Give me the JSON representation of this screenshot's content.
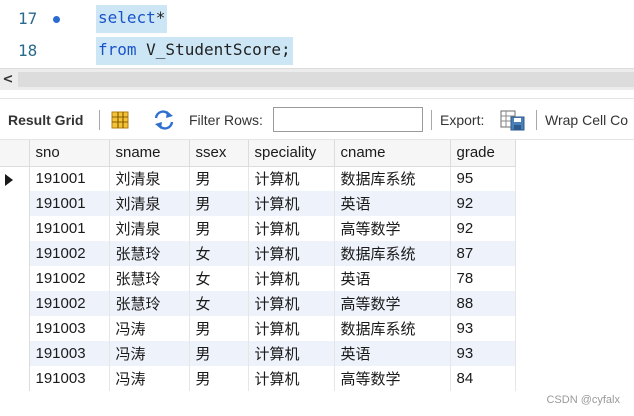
{
  "editor": {
    "lines": [
      {
        "number": "17",
        "text_keyword": "select",
        "text_rest": "*"
      },
      {
        "number": "18",
        "text_keyword": "from",
        "text_rest": " V_StudentScore;"
      }
    ]
  },
  "scrollbar": {
    "left_arrow": "<"
  },
  "toolbar": {
    "result_grid": "Result Grid",
    "filter_rows": "Filter Rows:",
    "filter_value": "",
    "export": "Export:",
    "wrap_cell": "Wrap Cell Co"
  },
  "grid": {
    "columns": [
      "sno",
      "sname",
      "ssex",
      "speciality",
      "cname",
      "grade"
    ],
    "rows": [
      [
        "191001",
        "刘清泉",
        "男",
        "计算机",
        "数据库系统",
        "95"
      ],
      [
        "191001",
        "刘清泉",
        "男",
        "计算机",
        "英语",
        "92"
      ],
      [
        "191001",
        "刘清泉",
        "男",
        "计算机",
        "高等数学",
        "92"
      ],
      [
        "191002",
        "张慧玲",
        "女",
        "计算机",
        "数据库系统",
        "87"
      ],
      [
        "191002",
        "张慧玲",
        "女",
        "计算机",
        "英语",
        "78"
      ],
      [
        "191002",
        "张慧玲",
        "女",
        "计算机",
        "高等数学",
        "88"
      ],
      [
        "191003",
        "冯涛",
        "男",
        "计算机",
        "数据库系统",
        "93"
      ],
      [
        "191003",
        "冯涛",
        "男",
        "计算机",
        "英语",
        "93"
      ],
      [
        "191003",
        "冯涛",
        "男",
        "计算机",
        "高等数学",
        "84"
      ]
    ]
  },
  "watermark": "CSDN @cyfalx",
  "colors": {
    "keyword": "#1a55c8",
    "selection": "#cce6f6",
    "alt_row": "#eef3fb"
  }
}
